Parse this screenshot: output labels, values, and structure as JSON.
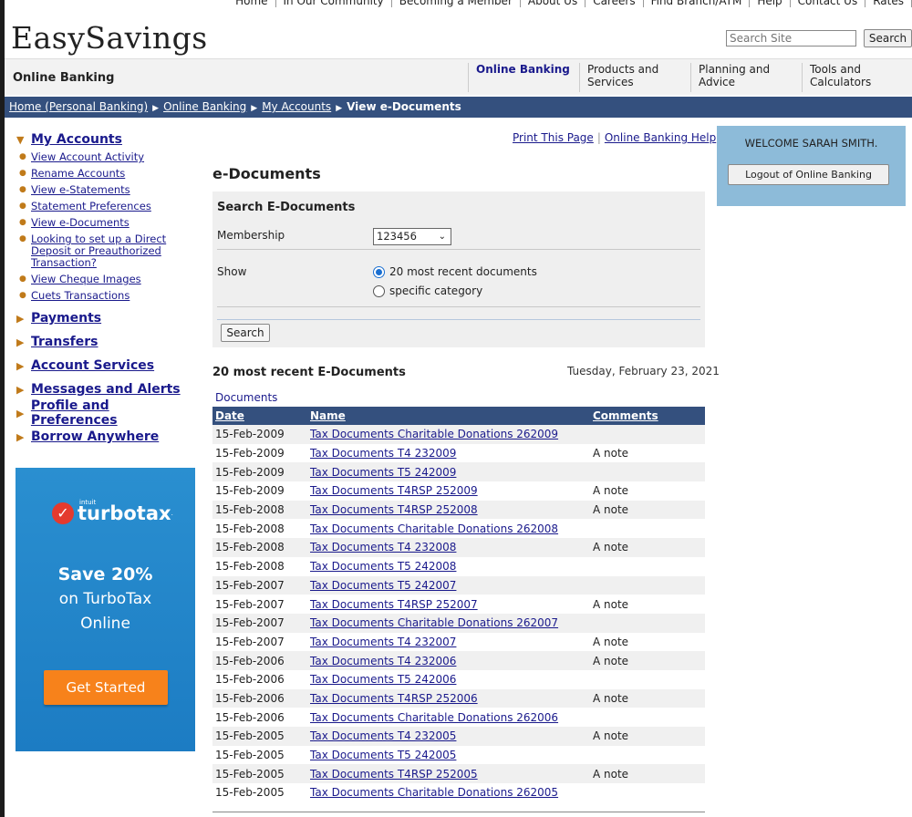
{
  "top_links": [
    "Home",
    "In Our Community",
    "Becoming a Member",
    "About Us",
    "Careers",
    "Find Branch/ATM",
    "Help",
    "Contact Us",
    "Rates"
  ],
  "brand": {
    "logo": "EasySavings"
  },
  "site_search": {
    "placeholder": "Search Site",
    "button": "Search"
  },
  "navbar": {
    "title": "Online Banking",
    "items": [
      {
        "label": "Online Banking"
      },
      {
        "label": "Products and Services"
      },
      {
        "label": "Planning and Advice"
      },
      {
        "label": "Tools and Calculators"
      }
    ]
  },
  "breadcrumb": {
    "items": [
      "Home (Personal Banking)",
      "Online Banking",
      "My Accounts"
    ],
    "current": "View e-Documents"
  },
  "sidebar": {
    "my_accounts": {
      "label": "My Accounts",
      "items": [
        "View Account Activity",
        "Rename Accounts",
        "View e-Statements",
        "Statement Preferences",
        "View e-Documents",
        "Looking to set up a Direct Deposit or Preauthorized Transaction?",
        "View Cheque Images",
        "Cuets Transactions"
      ]
    },
    "sections": [
      "Payments",
      "Transfers",
      "Account Services",
      "Messages and Alerts",
      "Profile and Preferences",
      "Borrow Anywhere"
    ]
  },
  "ad": {
    "intuit": "intuit",
    "brand": "turbotax",
    "headline": "Save 20%",
    "line2": "on TurboTax",
    "line3": "Online",
    "cta": "Get Started"
  },
  "page_links": {
    "print": "Print This Page",
    "help": "Online Banking Help"
  },
  "welcome": {
    "message": "WELCOME SARAH SMITH.",
    "logout": "Logout of Online Banking"
  },
  "page_title": "e-Documents",
  "search_form": {
    "heading": "Search E-Documents",
    "membership_label": "Membership",
    "membership_value": "123456",
    "show_label": "Show",
    "show_options": [
      "20 most recent documents",
      "specific category"
    ],
    "show_selected": 0,
    "button": "Search"
  },
  "results": {
    "heading": "20 most recent E-Documents",
    "date": "Tuesday, February 23, 2021",
    "label": "Documents",
    "columns": [
      "Date",
      "Name",
      "Comments"
    ],
    "rows": [
      {
        "date": "15-Feb-2009",
        "name": "Tax Documents Charitable Donations 262009",
        "comment": ""
      },
      {
        "date": "15-Feb-2009",
        "name": "Tax Documents T4 232009",
        "comment": "A note"
      },
      {
        "date": "15-Feb-2009",
        "name": "Tax Documents T5 242009",
        "comment": ""
      },
      {
        "date": "15-Feb-2009",
        "name": "Tax Documents T4RSP 252009",
        "comment": "A note"
      },
      {
        "date": "15-Feb-2008",
        "name": "Tax Documents T4RSP 252008",
        "comment": "A note"
      },
      {
        "date": "15-Feb-2008",
        "name": "Tax Documents Charitable Donations 262008",
        "comment": ""
      },
      {
        "date": "15-Feb-2008",
        "name": "Tax Documents T4 232008",
        "comment": "A note"
      },
      {
        "date": "15-Feb-2008",
        "name": "Tax Documents T5 242008",
        "comment": ""
      },
      {
        "date": "15-Feb-2007",
        "name": "Tax Documents T5 242007",
        "comment": ""
      },
      {
        "date": "15-Feb-2007",
        "name": "Tax Documents T4RSP 252007",
        "comment": "A note"
      },
      {
        "date": "15-Feb-2007",
        "name": "Tax Documents Charitable Donations 262007",
        "comment": ""
      },
      {
        "date": "15-Feb-2007",
        "name": "Tax Documents T4 232007",
        "comment": "A note"
      },
      {
        "date": "15-Feb-2006",
        "name": "Tax Documents T4 232006",
        "comment": "A note"
      },
      {
        "date": "15-Feb-2006",
        "name": "Tax Documents T5 242006",
        "comment": ""
      },
      {
        "date": "15-Feb-2006",
        "name": "Tax Documents T4RSP 252006",
        "comment": "A note"
      },
      {
        "date": "15-Feb-2006",
        "name": "Tax Documents Charitable Donations 262006",
        "comment": ""
      },
      {
        "date": "15-Feb-2005",
        "name": "Tax Documents T4 232005",
        "comment": "A note"
      },
      {
        "date": "15-Feb-2005",
        "name": "Tax Documents T5 242005",
        "comment": ""
      },
      {
        "date": "15-Feb-2005",
        "name": "Tax Documents T4RSP 252005",
        "comment": "A note"
      },
      {
        "date": "15-Feb-2005",
        "name": "Tax Documents Charitable Donations 262005",
        "comment": ""
      }
    ]
  }
}
